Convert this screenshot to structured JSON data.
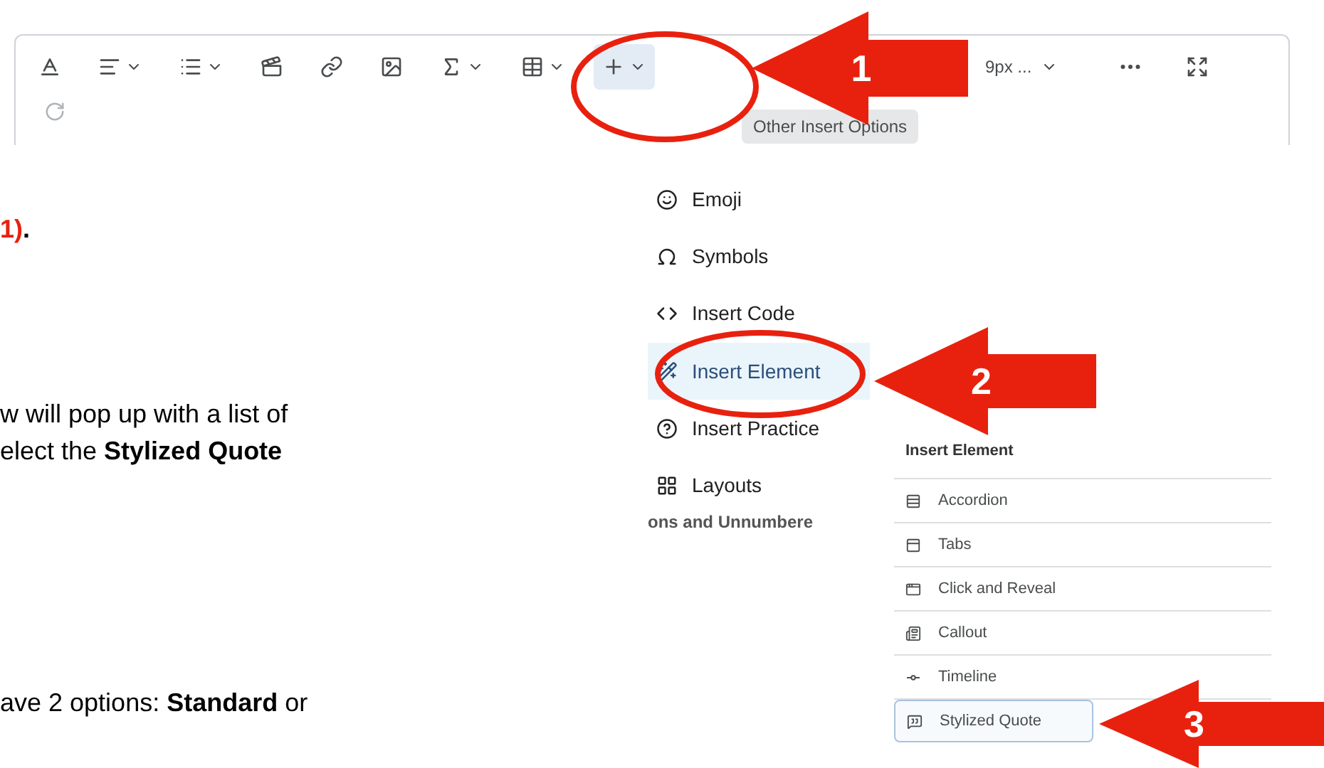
{
  "toolbar": {
    "items": [
      {
        "kind": "format",
        "dropdown": false,
        "selected": false
      },
      {
        "kind": "align",
        "dropdown": true,
        "selected": false
      },
      {
        "kind": "list",
        "dropdown": true,
        "selected": false
      },
      {
        "kind": "media",
        "dropdown": false,
        "selected": false
      },
      {
        "kind": "link",
        "dropdown": false,
        "selected": false
      },
      {
        "kind": "image",
        "dropdown": false,
        "selected": false
      },
      {
        "kind": "equation",
        "dropdown": true,
        "selected": false
      },
      {
        "kind": "table",
        "dropdown": true,
        "selected": false
      },
      {
        "kind": "insert",
        "dropdown": true,
        "selected": true
      }
    ],
    "size_label": "9px ...",
    "tooltip": "Other Insert Options"
  },
  "document": {
    "step_ref": {
      "highlight": "1)",
      "rest": "."
    },
    "paragraph_lines": [
      "w will pop up with a list of",
      "elect the **Stylized Quote**"
    ],
    "bottom_line": "ave 2 options: **Standard** or",
    "cut_text": "ons and Unnumbere"
  },
  "insert_menu": {
    "items": [
      {
        "label": "Emoji",
        "kind": "emoji",
        "selected": false
      },
      {
        "label": "Symbols",
        "kind": "symbols",
        "selected": false
      },
      {
        "label": "Insert Code",
        "kind": "code",
        "selected": false
      },
      {
        "label": "Insert Element",
        "kind": "element",
        "selected": true
      },
      {
        "label": "Insert Practice",
        "kind": "practice",
        "selected": false
      },
      {
        "label": "Layouts",
        "kind": "layouts",
        "selected": false
      }
    ]
  },
  "element_menu": {
    "title": "Insert Element",
    "items": [
      {
        "label": "Accordion",
        "kind": "accordion",
        "selected": false
      },
      {
        "label": "Tabs",
        "kind": "tabs",
        "selected": false
      },
      {
        "label": "Click and Reveal",
        "kind": "reveal",
        "selected": false
      },
      {
        "label": "Callout",
        "kind": "callout",
        "selected": false
      },
      {
        "label": "Timeline",
        "kind": "timeline",
        "selected": false
      },
      {
        "label": "Stylized Quote",
        "kind": "quote",
        "selected": true
      }
    ]
  },
  "callouts": [
    {
      "number": "1"
    },
    {
      "number": "2"
    },
    {
      "number": "3"
    }
  ]
}
